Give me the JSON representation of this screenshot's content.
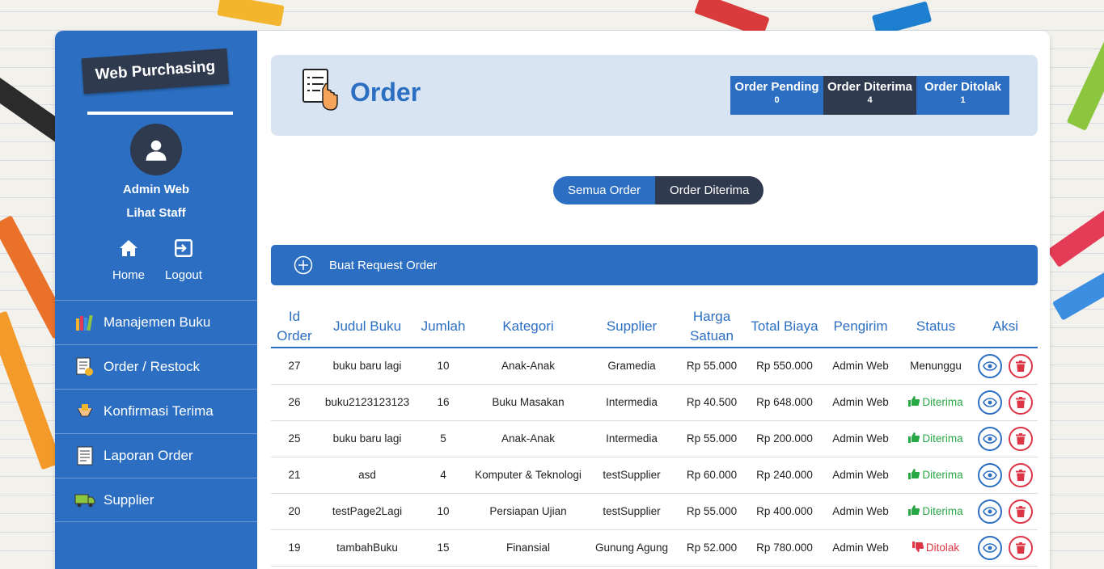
{
  "sidebar": {
    "brand": "Web Purchasing",
    "user_name": "Admin Web",
    "user_role": "Lihat Staff",
    "home_label": "Home",
    "logout_label": "Logout",
    "menu": [
      {
        "label": "Manajemen Buku",
        "icon": "books-icon"
      },
      {
        "label": "Order / Restock",
        "icon": "order-icon"
      },
      {
        "label": "Konfirmasi Terima",
        "icon": "handshake-icon"
      },
      {
        "label": "Laporan Order",
        "icon": "report-icon"
      },
      {
        "label": "Supplier",
        "icon": "truck-icon"
      }
    ]
  },
  "header": {
    "title": "Order",
    "stats": [
      {
        "label": "Order Pending",
        "value": "0"
      },
      {
        "label": "Order Diterima",
        "value": "4"
      },
      {
        "label": "Order Ditolak",
        "value": "1"
      }
    ]
  },
  "filter": {
    "all": "Semua Order",
    "received": "Order Diterima"
  },
  "create_label": "Buat Request Order",
  "table": {
    "headers": [
      "Id Order",
      "Judul Buku",
      "Jumlah",
      "Kategori",
      "Supplier",
      "Harga Satuan",
      "Total Biaya",
      "Pengirim",
      "Status",
      "Aksi"
    ],
    "rows": [
      {
        "id": "27",
        "title": "buku baru lagi",
        "qty": "10",
        "category": "Anak-Anak",
        "supplier": "Gramedia",
        "price": "Rp 55.000",
        "total": "Rp 550.000",
        "sender": "Admin Web",
        "status": "Menunggu",
        "status_type": "wait"
      },
      {
        "id": "26",
        "title": "buku2123123123",
        "qty": "16",
        "category": "Buku Masakan",
        "supplier": "Intermedia",
        "price": "Rp 40.500",
        "total": "Rp 648.000",
        "sender": "Admin Web",
        "status": "Diterima",
        "status_type": "ok"
      },
      {
        "id": "25",
        "title": "buku baru lagi",
        "qty": "5",
        "category": "Anak-Anak",
        "supplier": "Intermedia",
        "price": "Rp 55.000",
        "total": "Rp 200.000",
        "sender": "Admin Web",
        "status": "Diterima",
        "status_type": "ok"
      },
      {
        "id": "21",
        "title": "asd",
        "qty": "4",
        "category": "Komputer & Teknologi",
        "supplier": "testSupplier",
        "price": "Rp 60.000",
        "total": "Rp 240.000",
        "sender": "Admin Web",
        "status": "Diterima",
        "status_type": "ok"
      },
      {
        "id": "20",
        "title": "testPage2Lagi",
        "qty": "10",
        "category": "Persiapan Ujian",
        "supplier": "testSupplier",
        "price": "Rp 55.000",
        "total": "Rp 400.000",
        "sender": "Admin Web",
        "status": "Diterima",
        "status_type": "ok"
      },
      {
        "id": "19",
        "title": "tambahBuku",
        "qty": "15",
        "category": "Finansial",
        "supplier": "Gunung Agung",
        "price": "Rp 52.000",
        "total": "Rp 780.000",
        "sender": "Admin Web",
        "status": "Ditolak",
        "status_type": "no"
      }
    ]
  },
  "colors": {
    "primary": "#2c6fc2",
    "dark": "#2f3a4f",
    "success": "#28a745",
    "danger": "#dc3545"
  }
}
